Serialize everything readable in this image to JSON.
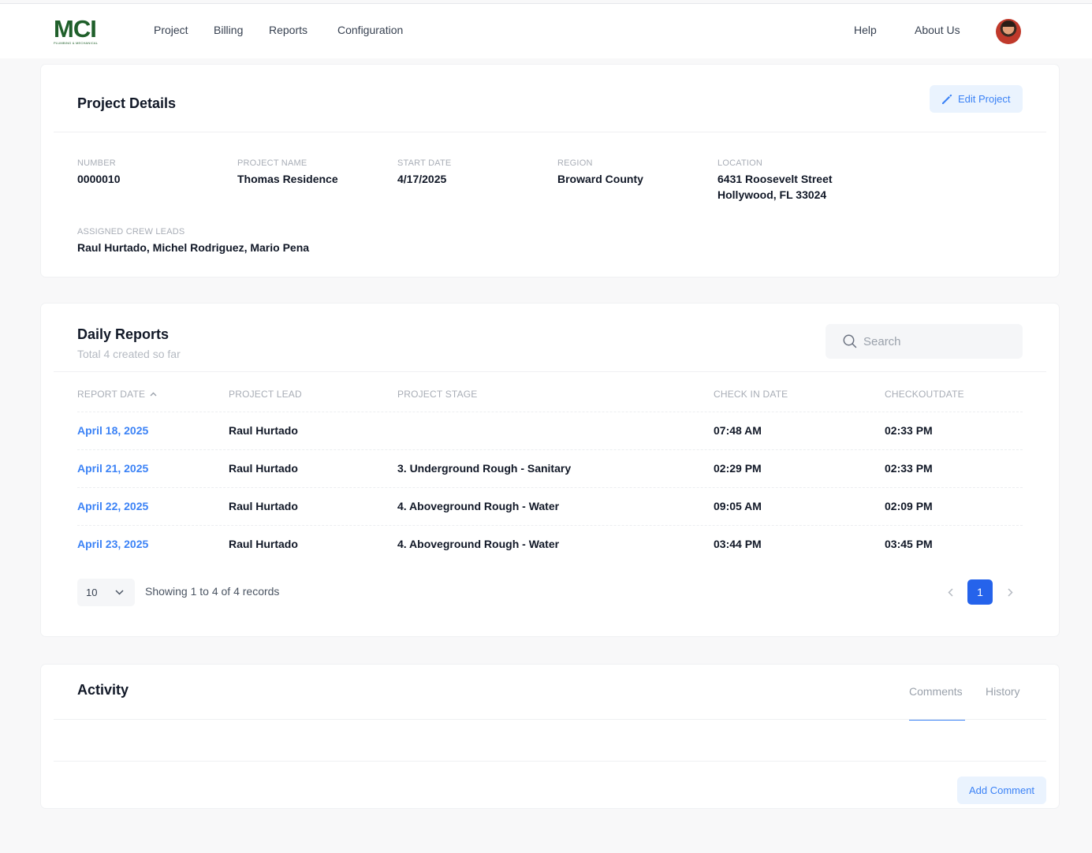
{
  "brand": {
    "logo_text": "MCI",
    "logo_subtext": "PLUMBING & MECHANICAL"
  },
  "nav": {
    "links": [
      "Project",
      "Billing",
      "Reports",
      "Configuration"
    ],
    "right_links": [
      "Help",
      "About Us"
    ]
  },
  "project": {
    "title": "Project Details",
    "edit_label": "Edit Project",
    "fields": {
      "number": {
        "label": "NUMBER",
        "value": "0000010"
      },
      "name": {
        "label": "PROJECT NAME",
        "value": "Thomas Residence"
      },
      "start_date": {
        "label": "START DATE",
        "value": "4/17/2025"
      },
      "region": {
        "label": "REGION",
        "value": "Broward County"
      },
      "location": {
        "label": "LOCATION",
        "line1": "6431 Roosevelt Street",
        "line2": "Hollywood, FL 33024"
      },
      "crew": {
        "label": "ASSIGNED CREW LEADS",
        "value": "Raul Hurtado, Michel Rodriguez, Mario Pena"
      }
    }
  },
  "reports": {
    "title": "Daily Reports",
    "subtitle": "Total 4 created so far",
    "search_placeholder": "Search",
    "columns": [
      "REPORT DATE",
      "PROJECT LEAD",
      "PROJECT STAGE",
      "CHECK IN DATE",
      "CHECKOUTDATE"
    ],
    "rows": [
      {
        "date": "April 18, 2025",
        "lead": "Raul Hurtado",
        "stage": "",
        "check_in": "07:48 AM",
        "check_out": "02:33 PM"
      },
      {
        "date": "April 21, 2025",
        "lead": "Raul Hurtado",
        "stage": "3. Underground Rough - Sanitary",
        "check_in": "02:29 PM",
        "check_out": "02:33 PM"
      },
      {
        "date": "April 22, 2025",
        "lead": "Raul Hurtado",
        "stage": "4. Aboveground Rough - Water",
        "check_in": "09:05 AM",
        "check_out": "02:09 PM"
      },
      {
        "date": "April 23, 2025",
        "lead": "Raul Hurtado",
        "stage": "4. Aboveground Rough - Water",
        "check_in": "03:44 PM",
        "check_out": "03:45 PM"
      }
    ],
    "page_size": "10",
    "showing_text": "Showing 1 to 4 of 4 records",
    "current_page": "1"
  },
  "activity": {
    "title": "Activity",
    "tabs": [
      "Comments",
      "History"
    ],
    "add_comment_label": "Add Comment"
  },
  "colors": {
    "accent": "#3b82f6",
    "page_active": "#2563eb",
    "logo_green": "#1f5f2a"
  }
}
